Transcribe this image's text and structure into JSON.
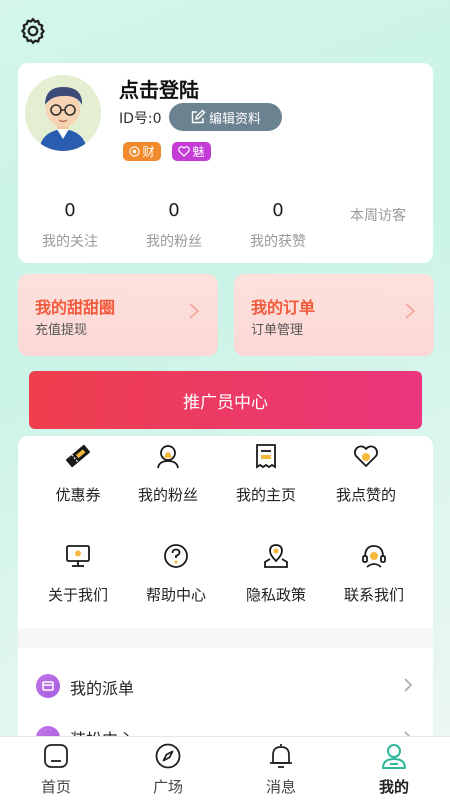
{
  "header": {
    "settings_icon": "gear-icon"
  },
  "profile": {
    "username": "点击登陆",
    "id_text": "ID号:0",
    "edit_label": "编辑资料",
    "badge_wealth": "财",
    "badge_charm": "魅"
  },
  "stats": [
    {
      "value": "0",
      "label": "我的关注"
    },
    {
      "value": "0",
      "label": "我的粉丝"
    },
    {
      "value": "0",
      "label": "我的获赞"
    }
  ],
  "visitors_label": "本周访客",
  "cards": [
    {
      "title": "我的甜甜圈",
      "subtitle": "充值提现"
    },
    {
      "title": "我的订单",
      "subtitle": "订单管理"
    }
  ],
  "promoter_label": "推广员中心",
  "grid": [
    {
      "label": "优惠券",
      "icon": "ticket-icon"
    },
    {
      "label": "我的粉丝",
      "icon": "user-icon"
    },
    {
      "label": "我的主页",
      "icon": "receipt-icon"
    },
    {
      "label": "我点赞的",
      "icon": "heart-icon"
    },
    {
      "label": "关于我们",
      "icon": "monitor-icon"
    },
    {
      "label": "帮助中心",
      "icon": "help-icon"
    },
    {
      "label": "隐私政策",
      "icon": "location-icon"
    },
    {
      "label": "联系我们",
      "icon": "headset-icon"
    }
  ],
  "list": [
    {
      "label": "我的派单",
      "icon": "dispatch-icon"
    },
    {
      "label": "装扮中心",
      "icon": "dressup-icon"
    }
  ],
  "tabs": [
    {
      "label": "首页",
      "icon": "home-icon"
    },
    {
      "label": "广场",
      "icon": "compass-icon"
    },
    {
      "label": "消息",
      "icon": "bell-icon"
    },
    {
      "label": "我的",
      "icon": "person-icon",
      "active": true
    }
  ],
  "colors": {
    "accent": "#2fb79a",
    "promoter_start": "#ef3f4c",
    "promoter_end": "#e9367d",
    "card_title": "#f25a3c",
    "badge_wealth": "#f08a2c",
    "badge_charm": "#c53bd6"
  }
}
